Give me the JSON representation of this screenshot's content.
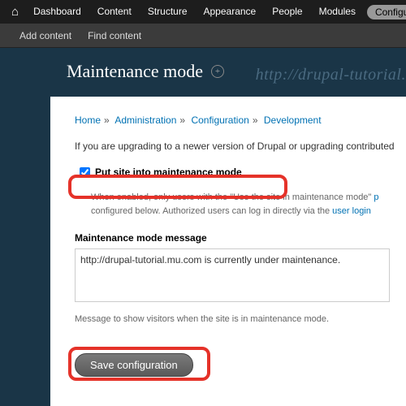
{
  "adminBar": {
    "items": [
      "Dashboard",
      "Content",
      "Structure",
      "Appearance",
      "People",
      "Modules"
    ],
    "pill": "Configuration"
  },
  "subBar": {
    "items": [
      "Add content",
      "Find content"
    ]
  },
  "page": {
    "title": "Maintenance mode",
    "watermark": "http://drupal-tutorial."
  },
  "breadcrumb": [
    "Home",
    "Administration",
    "Configuration",
    "Development"
  ],
  "intro": "If you are upgrading to a newer version of Drupal or upgrading contributed",
  "checkbox": {
    "label": "Put site into maintenance mode",
    "checked": true,
    "desc1": "When enabled, only users with the \"Use the site in maintenance mode\" ",
    "descLink1": "p",
    "desc2": "configured below. Authorized users can log in directly via the ",
    "descLink2": "user login"
  },
  "message": {
    "label": "Maintenance mode message",
    "value": "http://drupal-tutorial.mu.com is currently under maintenance.",
    "help": "Message to show visitors when the site is in maintenance mode."
  },
  "save": "Save configuration"
}
